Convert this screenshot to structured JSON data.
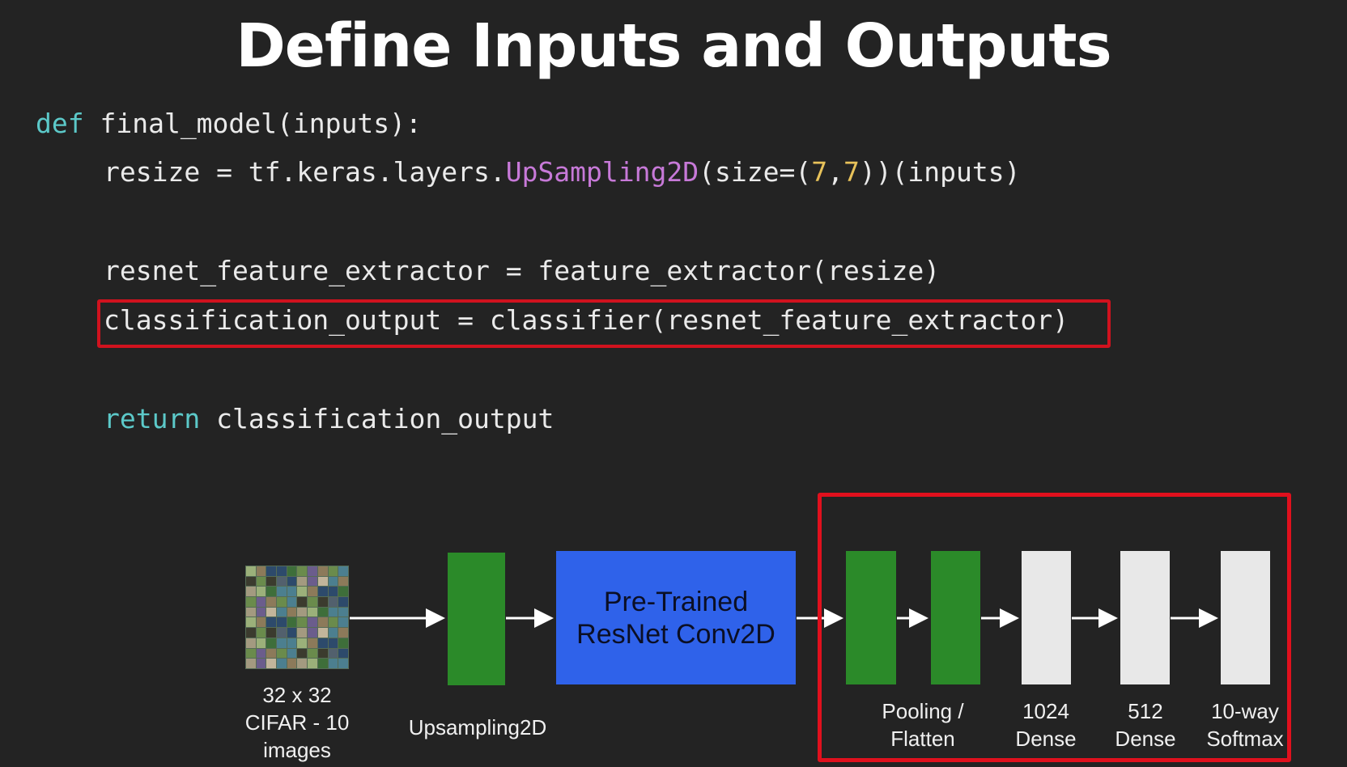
{
  "title": "Define Inputs and Outputs",
  "code": {
    "line1": {
      "kw": "def",
      "rest": " final_model(inputs):"
    },
    "line2": {
      "pre": "resize = tf.keras.layers.",
      "fn": "UpSampling2D",
      "mid": "(size=(",
      "n1": "7",
      "comma": ",",
      "n2": "7",
      "post": "))(inputs)"
    },
    "line3": "resnet_feature_extractor = feature_extractor(resize)",
    "line4": "classification_output = classifier(resnet_feature_extractor)",
    "line5": {
      "kw": "return",
      "rest": " classification_output"
    }
  },
  "diagram": {
    "input_label": "32 x 32\nCIFAR - 10\nimages",
    "upsampling_label": "Upsampling2D",
    "resnet_label": "Pre-Trained\nResNet Conv2D",
    "pooling_label": "Pooling /\nFlatten",
    "dense1024_label": "1024\nDense",
    "dense512_label": "512\nDense",
    "softmax_label": "10-way\nSoftmax"
  },
  "colors": {
    "background": "#232323",
    "keyword": "#5cc9c9",
    "function": "#c779d8",
    "number": "#e8c25a",
    "highlight": "#e0101d",
    "green_layer": "#2b8a29",
    "resnet_block": "#2f62ea",
    "dense_layer": "#e8e8e8"
  }
}
